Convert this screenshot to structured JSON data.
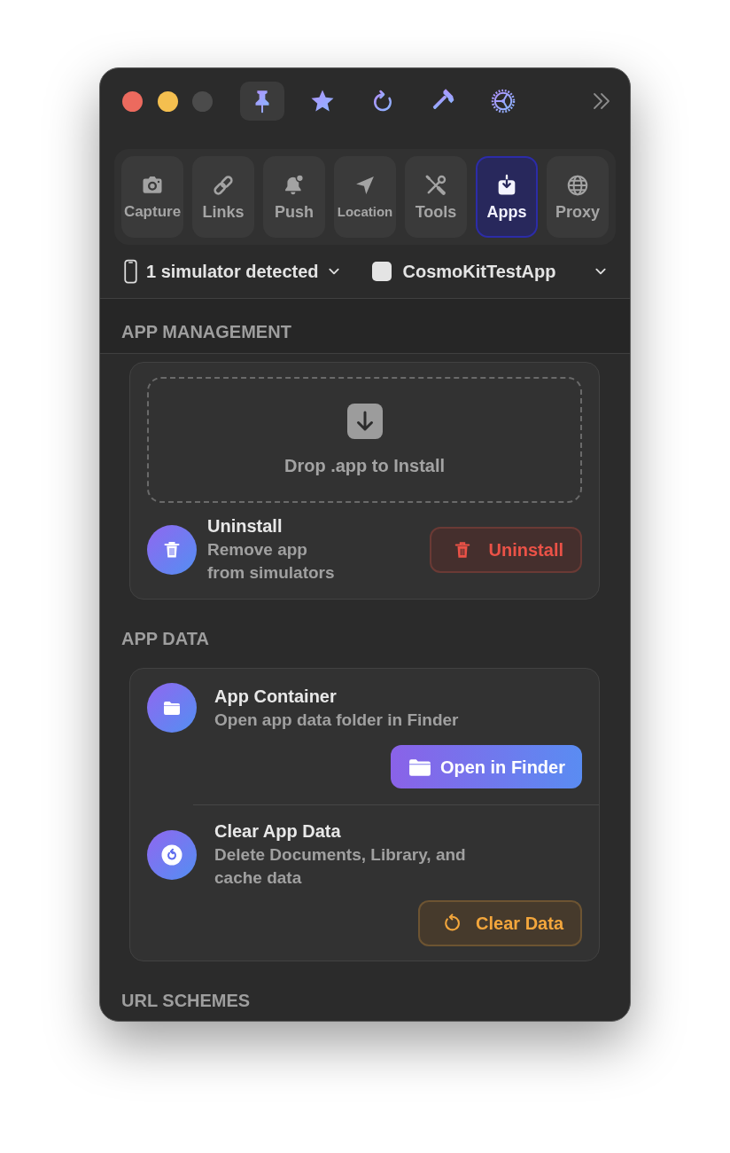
{
  "window": {
    "controls": [
      {
        "kind": "close",
        "disabled": false
      },
      {
        "kind": "minimize",
        "disabled": false
      },
      {
        "kind": "zoom",
        "disabled": true
      }
    ]
  },
  "toolbar": [
    {
      "kind": "pin",
      "selected": true
    },
    {
      "kind": "star",
      "selected": false
    },
    {
      "kind": "refresh",
      "selected": false
    },
    {
      "kind": "hammer",
      "selected": false
    },
    {
      "kind": "gear",
      "selected": false
    }
  ],
  "tabs": [
    {
      "label": "Capture",
      "kind": "camera",
      "selected": false
    },
    {
      "label": "Links",
      "kind": "link",
      "selected": false
    },
    {
      "label": "Push",
      "kind": "bell",
      "selected": false
    },
    {
      "label": "Location",
      "kind": "location",
      "selected": false
    },
    {
      "label": "Tools",
      "kind": "tools",
      "selected": false
    },
    {
      "label": "Apps",
      "kind": "install",
      "selected": true
    },
    {
      "label": "Proxy",
      "kind": "globe",
      "selected": false
    }
  ],
  "device_bar": {
    "simulators": "1 simulator detected",
    "app": "CosmoKitTestApp"
  },
  "sections": [
    {
      "title": "APP MANAGEMENT",
      "kind": "banner",
      "drop_zone": {
        "label": "Drop .app to Install"
      },
      "rows": [
        {
          "kind": "uninstall",
          "title": "Uninstall",
          "subtitle": "Remove app from simulators",
          "button": {
            "label": "Uninstall"
          }
        }
      ]
    },
    {
      "title": "APP DATA",
      "kind": "plain",
      "rows": [
        {
          "kind": "container",
          "title": "App Container",
          "subtitle": "Open app data folder in Finder",
          "button": {
            "label": "Open in Finder"
          }
        },
        {
          "kind": "clear",
          "title": "Clear App Data",
          "subtitle": "Delete Documents, Library, and cache data",
          "button": {
            "label": "Clear Data"
          }
        }
      ]
    },
    {
      "title": "URL SCHEMES",
      "kind": "plain"
    }
  ]
}
